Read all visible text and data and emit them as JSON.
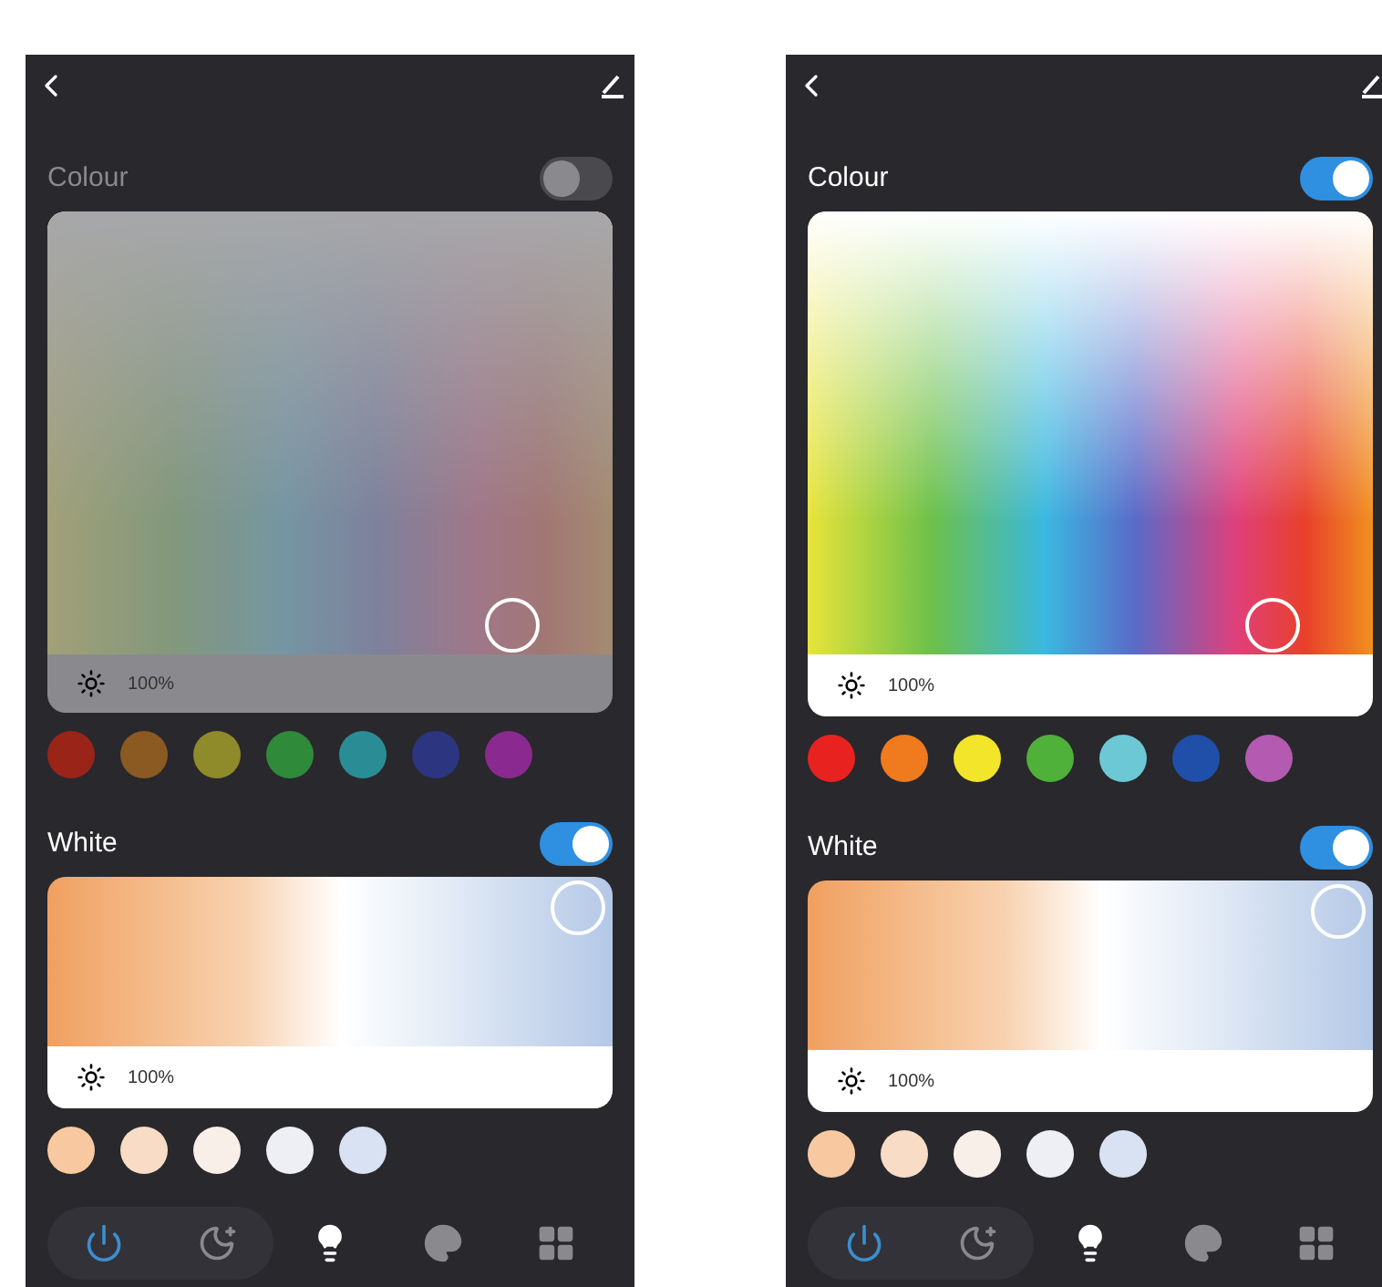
{
  "phones": [
    {
      "colour": {
        "title": "Colour",
        "on": false,
        "brightness": "100%",
        "swatches": [
          {
            "color": "#9a2418"
          },
          {
            "color": "#8a5a22"
          },
          {
            "color": "#8f8a2a"
          },
          {
            "color": "#2f8a3a"
          },
          {
            "color": "#2a8d95"
          },
          {
            "color": "#2c3580"
          },
          {
            "color": "#8a2a90"
          }
        ]
      },
      "white": {
        "title": "White",
        "on": true,
        "brightness": "100%",
        "swatches": [
          {
            "color": "#f8c9a0"
          },
          {
            "color": "#f9dcc6"
          },
          {
            "color": "#f8efe9"
          },
          {
            "color": "#eeeef5"
          },
          {
            "color": "#d9e2f2"
          }
        ]
      },
      "nav": {
        "group": [
          {
            "kind": "power",
            "selected": false
          },
          {
            "kind": "moon",
            "selected": false
          }
        ],
        "items": [
          {
            "kind": "bulb",
            "selected": true
          },
          {
            "kind": "palette",
            "selected": false
          },
          {
            "kind": "grid",
            "selected": false
          }
        ]
      }
    },
    {
      "colour": {
        "title": "Colour",
        "on": true,
        "brightness": "100%",
        "swatches": [
          {
            "color": "#e8231f"
          },
          {
            "color": "#f07a1e"
          },
          {
            "color": "#f2e52a"
          },
          {
            "color": "#4fb03a"
          },
          {
            "color": "#6cc8d4"
          },
          {
            "color": "#1f4fa8"
          },
          {
            "color": "#b45ab0"
          }
        ]
      },
      "white": {
        "title": "White",
        "on": true,
        "brightness": "100%",
        "swatches": [
          {
            "color": "#f8c9a0"
          },
          {
            "color": "#f9dcc6"
          },
          {
            "color": "#f8efe9"
          },
          {
            "color": "#eeeef5"
          },
          {
            "color": "#d9e2f2"
          }
        ]
      },
      "nav": {
        "group": [
          {
            "kind": "power",
            "selected": false
          },
          {
            "kind": "moon",
            "selected": false
          }
        ],
        "items": [
          {
            "kind": "bulb",
            "selected": true
          },
          {
            "kind": "palette",
            "selected": false
          },
          {
            "kind": "grid",
            "selected": false
          }
        ]
      }
    }
  ]
}
